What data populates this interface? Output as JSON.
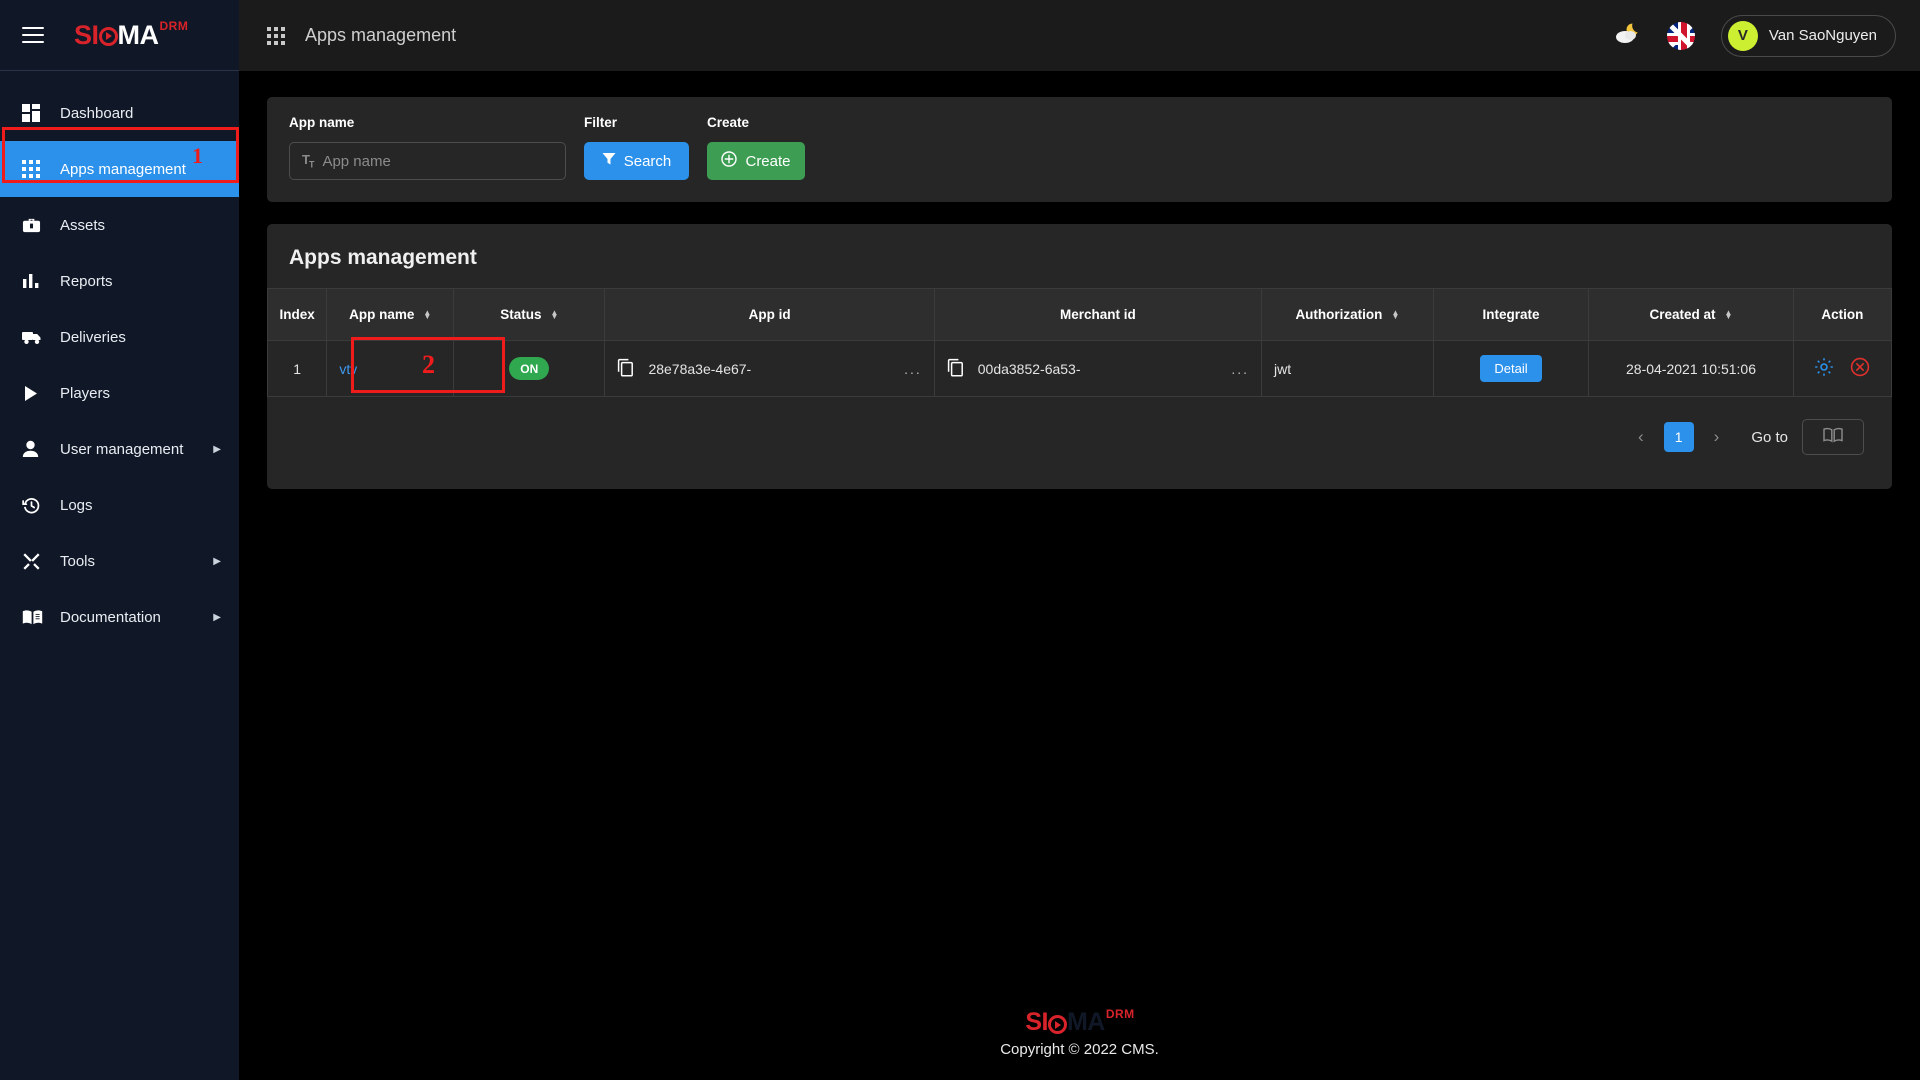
{
  "brand": {
    "si": "SI",
    "ma": "MA",
    "drm": "DRM"
  },
  "sidebar": {
    "items": [
      {
        "label": "Dashboard",
        "icon": "dashboard-icon",
        "active": false,
        "caret": ""
      },
      {
        "label": "Apps management",
        "icon": "apps-grid-icon",
        "active": true,
        "caret": ""
      },
      {
        "label": "Assets",
        "icon": "briefcase-icon",
        "active": false,
        "caret": ""
      },
      {
        "label": "Reports",
        "icon": "bar-chart-icon",
        "active": false,
        "caret": ""
      },
      {
        "label": "Deliveries",
        "icon": "truck-icon",
        "active": false,
        "caret": ""
      },
      {
        "label": "Players",
        "icon": "play-icon",
        "active": false,
        "caret": ""
      },
      {
        "label": "User management",
        "icon": "user-icon",
        "active": false,
        "caret": "▶"
      },
      {
        "label": "Logs",
        "icon": "history-clock-icon",
        "active": false,
        "caret": ""
      },
      {
        "label": "Tools",
        "icon": "tools-icon",
        "active": false,
        "caret": "▶"
      },
      {
        "label": "Documentation",
        "icon": "open-book-icon",
        "active": false,
        "caret": "▶"
      }
    ]
  },
  "annotations": [
    {
      "id": "1",
      "target": "sidebar-item-apps-management"
    },
    {
      "id": "2",
      "target": "app-name-cell"
    }
  ],
  "topbar": {
    "title": "Apps management",
    "menu_icon": "apps-grid-icon",
    "theme_icon": "moon-cloud-icon",
    "language_icon": "uk-flag-icon",
    "user": {
      "initial": "V",
      "name": "Van SaoNguyen"
    }
  },
  "filter": {
    "app_name_label": "App name",
    "app_name_placeholder": "App name",
    "app_name_value": "",
    "app_name_prefix_icon": "text-format-icon",
    "filter_label": "Filter",
    "search_button": "Search",
    "search_icon": "funnel-icon",
    "create_label": "Create",
    "create_button": "Create",
    "create_icon": "plus-circle-icon"
  },
  "table": {
    "title": "Apps management",
    "columns": [
      {
        "label": "Index",
        "sortable": false
      },
      {
        "label": "App name",
        "sortable": true
      },
      {
        "label": "Status",
        "sortable": true
      },
      {
        "label": "App id",
        "sortable": false
      },
      {
        "label": "Merchant id",
        "sortable": false
      },
      {
        "label": "Authorization",
        "sortable": true
      },
      {
        "label": "Integrate",
        "sortable": false
      },
      {
        "label": "Created at",
        "sortable": true
      },
      {
        "label": "Action",
        "sortable": false
      }
    ],
    "rows": [
      {
        "index": "1",
        "app_name": "vtv",
        "status": "ON",
        "app_id": "28e78a3e-4e67-",
        "app_id_overflow": "...",
        "merchant_id": "00da3852-6a53-",
        "merchant_id_overflow": "...",
        "authorization": "jwt",
        "integrate_button": "Detail",
        "created_at": "28-04-2021 10:51:06",
        "action_settings_icon": "gear-icon",
        "action_delete_icon": "delete-circle-icon"
      }
    ]
  },
  "pagination": {
    "prev_icon": "chevron-left-icon",
    "next_icon": "chevron-right-icon",
    "current_page": "1",
    "goto_label": "Go to",
    "goto_icon": "book-icon"
  },
  "footer": {
    "copyright": "Copyright © 2022 CMS."
  },
  "colors": {
    "accent_blue": "#2b91eb",
    "green": "#3d9e53",
    "status_green": "#2fa84f",
    "brand_red": "#d8232a",
    "annotation_red": "#f01b1b",
    "sidebar_bg": "#101726",
    "card_bg": "#262626",
    "avatar_bg": "#ccf031"
  }
}
